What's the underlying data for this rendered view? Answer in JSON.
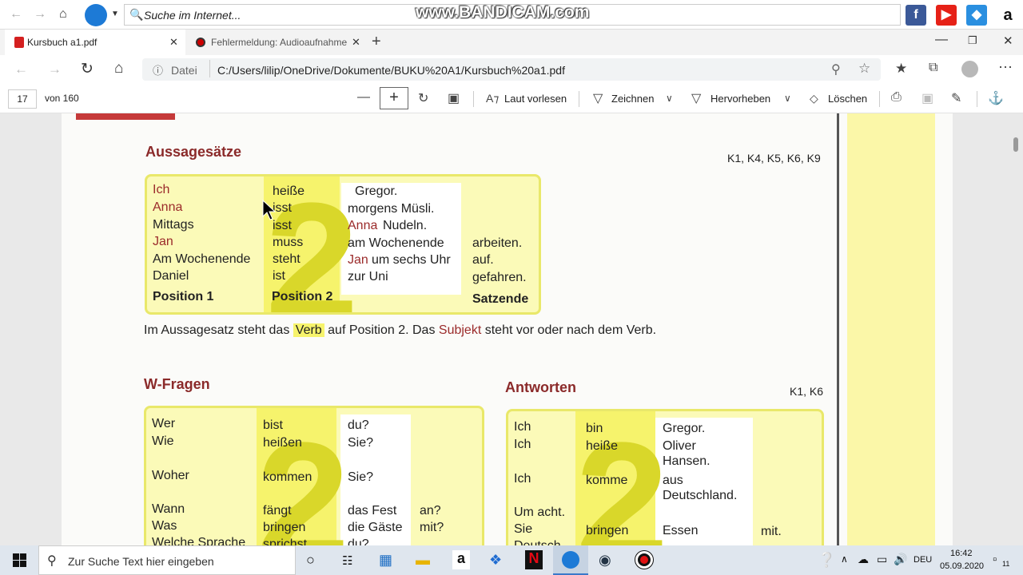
{
  "watermark": "www.BANDICAM.com",
  "topbar": {
    "search_placeholder": "Suche im Internet..."
  },
  "tabs": [
    {
      "title": "Kursbuch a1.pdf",
      "active": true
    },
    {
      "title": "Fehlermeldung: Audioaufnahme",
      "active": false
    }
  ],
  "address": {
    "prefix": "Datei",
    "url": "C:/Users/lilip/OneDrive/Dokumente/BUKU%20A1/Kursbuch%20a1.pdf"
  },
  "pdf_toolbar": {
    "page_number": "17",
    "page_total": "von 160",
    "read_aloud": "Laut vorlesen",
    "draw": "Zeichnen",
    "highlight": "Hervorheben",
    "erase": "Löschen"
  },
  "page": {
    "section1": {
      "title": "Aussagesätze",
      "refs": "K1, K4, K5, K6, K9",
      "col1": [
        "Ich",
        "Anna",
        "Mittags",
        "Jan",
        "Am Wochenende",
        "Daniel"
      ],
      "col2": [
        "heiße",
        "isst",
        "isst",
        "muss",
        "steht",
        "ist"
      ],
      "col3": [
        "Gregor.",
        "morgens Müsli.",
        "Nudeln.",
        "am Wochenende",
        "um sechs Uhr",
        "zur Uni"
      ],
      "col3_prefix_anna": "Anna",
      "col3_prefix_jan": "Jan",
      "col4": [
        "arbeiten.",
        "auf.",
        "gefahren."
      ],
      "footer": [
        "Position 1",
        "Position 2",
        "Satzende"
      ],
      "big_number": "2",
      "rule_parts": [
        "Im Aussagesatz steht das",
        "Verb",
        "auf Position 2. Das",
        "Subjekt",
        "steht vor oder nach dem Verb."
      ]
    },
    "section2": {
      "title": "W-Fragen",
      "col1": [
        "Wer",
        "Wie",
        "Woher",
        "Wann",
        "Was",
        "Welche Sprache"
      ],
      "col2": [
        "bist",
        "heißen",
        "kommen",
        "fängt",
        "bringen",
        "sprichst"
      ],
      "col3": [
        "du?",
        "Sie?",
        "Sie?",
        "das Fest",
        "die Gäste",
        "du?"
      ],
      "col4": [
        "an?",
        "mit?"
      ],
      "big_number": "2"
    },
    "section3": {
      "title": "Antworten",
      "refs": "K1, K6",
      "col1": [
        "Ich",
        "Ich",
        "Ich",
        "Um acht.",
        "Sie"
      ],
      "col2": [
        "bin",
        "heiße",
        "komme",
        "bringen"
      ],
      "col3": [
        "Gregor.",
        "Oliver",
        "Hansen.",
        "aus",
        "Deutschland.",
        "Essen"
      ],
      "col4": [
        "mit."
      ],
      "col1_cut": "Deutsch",
      "big_number": "2"
    }
  },
  "taskbar": {
    "search_placeholder": "Zur Suche Text hier eingeben",
    "lang": "DEU",
    "time": "16:42",
    "date": "05.09.2020",
    "notif_count": "11"
  },
  "colors": {
    "accent_red": "#9b2b2b",
    "box_yellow": "#fbfab8",
    "box_border": "#e9e86a"
  }
}
